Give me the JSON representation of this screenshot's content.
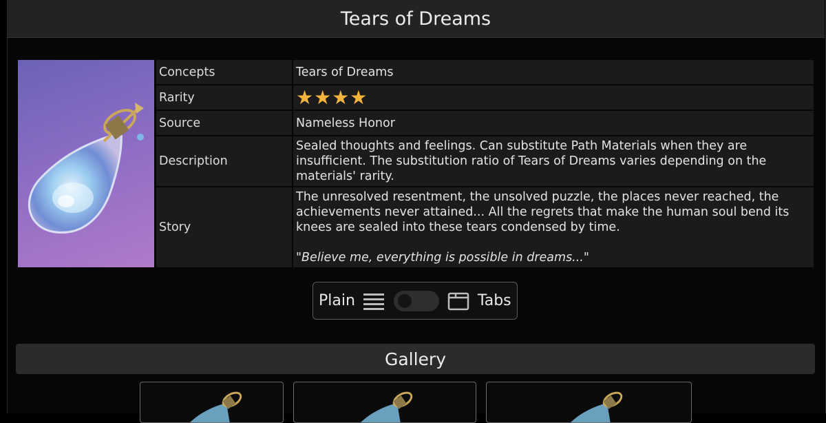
{
  "page": {
    "title": "Tears of Dreams"
  },
  "item": {
    "image_icon": "tear-drop-pendant-icon",
    "rows": {
      "concepts": {
        "label": "Concepts",
        "value": "Tears of Dreams"
      },
      "rarity": {
        "label": "Rarity",
        "stars": 4,
        "stars_text": "★★★★"
      },
      "source": {
        "label": "Source",
        "value": "Nameless Honor"
      },
      "description": {
        "label": "Description",
        "value": "Sealed thoughts and feelings. Can substitute Path Materials when they are insufficient. The substitution ratio of Tears of Dreams varies depending on the materials' rarity."
      },
      "story": {
        "label": "Story",
        "value": "The unresolved resentment, the unsolved puzzle, the places never reached, the achievements never attained... All the regrets that make the human soul bend its knees are sealed into these tears condensed by time.",
        "quote": "\"Believe me, everything is possible in dreams...\""
      }
    }
  },
  "view_toggle": {
    "plain_label": "Plain",
    "tabs_label": "Tabs",
    "plain_icon": "list-icon",
    "tabs_icon": "window-tab-icon",
    "mode": "Plain"
  },
  "gallery": {
    "title": "Gallery",
    "thumb_icon": "tear-drop-pendant-icon"
  },
  "colors": {
    "star": "#f3b33d",
    "image_background": "#8b6cc4",
    "panel": "#1b1b1b"
  }
}
